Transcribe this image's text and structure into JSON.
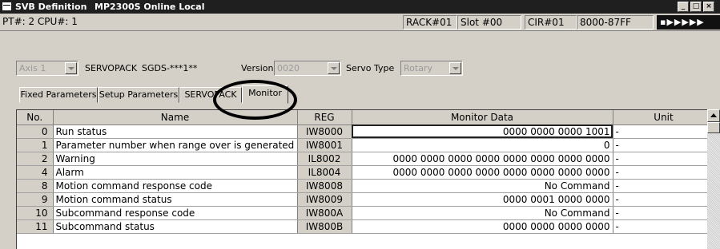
{
  "window": {
    "title_main": "SVB Definition",
    "title_sub": "MP2300S  Online  Local",
    "buttons": [
      "_",
      "□",
      "×"
    ]
  },
  "status": {
    "pt_cpu": "PT#: 2 CPU#: 1",
    "rack": "RACK#01",
    "slot": "Slot #00",
    "cir": "CIR#01",
    "range": "8000-87FF",
    "led": "▪▶▶▶▶▶"
  },
  "axis": {
    "axis_value": "Axis 1",
    "servopack_label": "SERVOPACK",
    "servopack_value": "SGDS-***1**",
    "version_label": "Version",
    "version_value": "0020",
    "servo_type_label": "Servo Type",
    "servo_type_value": "Rotary"
  },
  "tabs": [
    {
      "label": "Fixed Parameters"
    },
    {
      "label": "Setup Parameters"
    },
    {
      "label": "SERVOPACK"
    },
    {
      "label": "Monitor"
    }
  ],
  "table": {
    "headers": {
      "no": "No.",
      "name": "Name",
      "reg": "REG",
      "monitor": "Monitor Data",
      "unit": "Unit"
    },
    "rows": [
      {
        "no": "0",
        "name": "Run status",
        "reg": "IW8000",
        "monitor": "0000 0000 0000 1001",
        "unit": "-"
      },
      {
        "no": "1",
        "name": "Parameter number when range over is generated",
        "reg": "IW8001",
        "monitor": "0",
        "unit": "-"
      },
      {
        "no": "2",
        "name": "Warning",
        "reg": "IL8002",
        "monitor": "0000 0000 0000 0000 0000 0000 0000 0000",
        "unit": "-"
      },
      {
        "no": "4",
        "name": "Alarm",
        "reg": "IL8004",
        "monitor": "0000 0000 0000 0000 0000 0000 0000 0000",
        "unit": "-"
      },
      {
        "no": "8",
        "name": "Motion command response code",
        "reg": "IW8008",
        "monitor": "No Command",
        "unit": "-"
      },
      {
        "no": "9",
        "name": "Motion command status",
        "reg": "IW8009",
        "monitor": "0000 0001 0000 0000",
        "unit": "-"
      },
      {
        "no": "10",
        "name": "Subcommand response code",
        "reg": "IW800A",
        "monitor": "No Command",
        "unit": "-"
      },
      {
        "no": "11",
        "name": "Subcommand status",
        "reg": "IW800B",
        "monitor": "0000 0000 0000 0000",
        "unit": "-"
      }
    ]
  }
}
